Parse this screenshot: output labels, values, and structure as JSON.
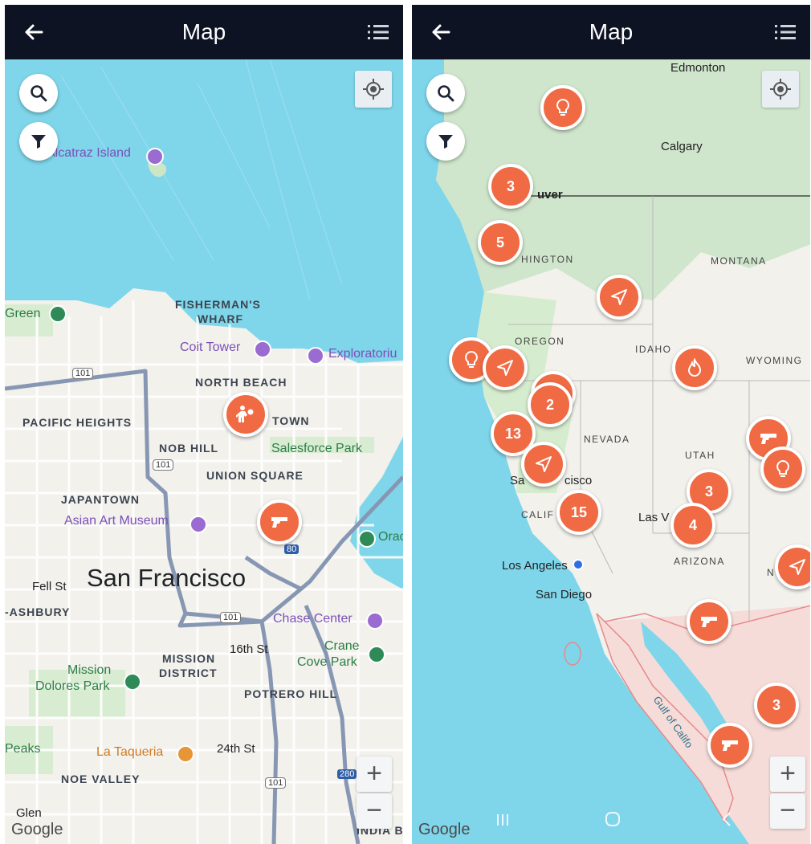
{
  "left": {
    "title": "Map",
    "map_labels": {
      "alcatraz": "Alcatraz Island",
      "fishermans_wharf_1": "FISHERMAN'S",
      "fishermans_wharf_2": "WHARF",
      "green": "Green",
      "coit_tower": "Coit Tower",
      "exploratorium": "Exploratoriu",
      "north_beach": "NORTH BEACH",
      "pacific_heights": "PACIFIC HEIGHTS",
      "chinatown_partial": "TOWN",
      "nob_hill": "NOB HILL",
      "salesforce_park": "Salesforce Park",
      "union_square": "UNION SQUARE",
      "japantown": "JAPANTOWN",
      "asian_art_museum": "Asian Art Museum",
      "oracle_partial": "Orac",
      "fell_st": "Fell St",
      "san_francisco": "San Francisco",
      "haight_ashbury": "-ASHBURY",
      "chase_center": "Chase Center",
      "mission_district_1": "MISSION",
      "mission_district_2": "DISTRICT",
      "sixteenth_st": "16th St",
      "crane_cove_1": "Crane",
      "crane_cove_2": "Cove Park",
      "mission_dolores_1": "Mission",
      "mission_dolores_2": "Dolores Park",
      "potrero_hill": "POTRERO HILL",
      "twin_peaks_partial": "Peaks",
      "la_taqueria": "La Taqueria",
      "twentyfourth_st": "24th St",
      "noe_valley": "NOE VALLEY",
      "glen": "Glen",
      "india_basin": "INDIA B",
      "hwy_101_a": "101",
      "hwy_101_b": "101",
      "hwy_101_c": "101",
      "hwy_101_d": "101",
      "hwy_80": "80",
      "hwy_280": "280"
    },
    "zoom_in": "+",
    "zoom_out": "−",
    "attribution": "Google"
  },
  "right": {
    "title": "Map",
    "map_labels": {
      "edmonton": "Edmonton",
      "calgary": "Calgary",
      "vancouver_partial": "uver",
      "washington_partial": "HINGTON",
      "montana": "MONTANA",
      "oregon": "OREGON",
      "idaho": "IDAHO",
      "wyoming": "WYOMING",
      "nevada": "NEVADA",
      "utah": "UTAH",
      "san_francisco_partial_1": "Sa",
      "san_francisco_partial_2": "cisco",
      "california_partial": "CALIF",
      "las_vegas_partial": "Las V",
      "arizona": "ARIZONA",
      "los_angeles": "Los Angeles",
      "san_diego": "San Diego",
      "new_mexico_partial": "N",
      "gulf_of_california": "Gulf of Califo"
    },
    "cluster_counts": [
      "3",
      "5",
      "2",
      "13",
      "15",
      "3",
      "4",
      "3"
    ],
    "zoom_in": "+",
    "zoom_out": "−",
    "attribution": "Google"
  },
  "icons": {
    "back": "arrow-left-icon",
    "menu": "list-icon",
    "search": "search-icon",
    "filter": "filter-icon",
    "location": "my-location-icon",
    "gun": "gun-icon",
    "person": "person-conflict-icon",
    "lightbulb": "lightbulb-icon",
    "navigate": "navigation-arrow-icon",
    "fire": "fire-icon"
  },
  "colors": {
    "header": "#0d1323",
    "marker": "#f06a43",
    "water": "#7fd6ea",
    "land": "#f2f1ec"
  }
}
